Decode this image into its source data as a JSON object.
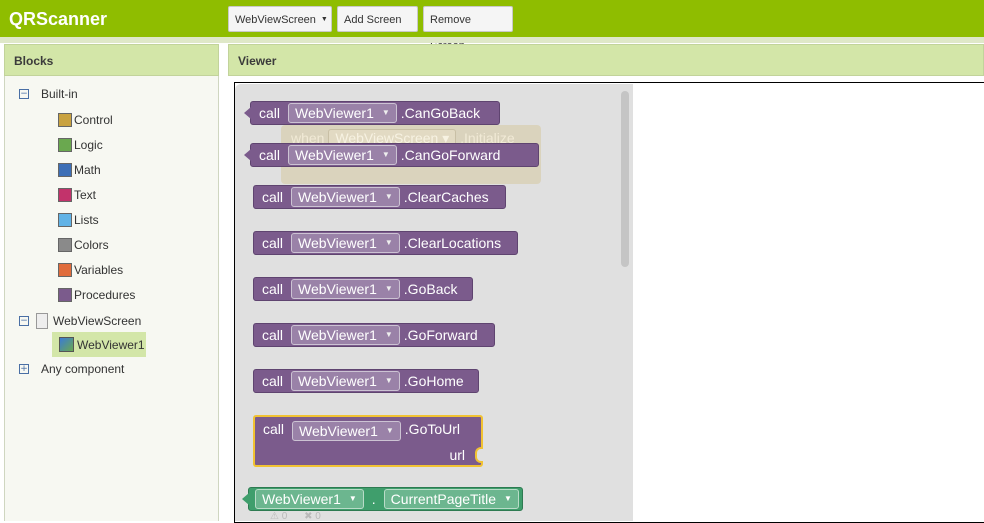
{
  "app": {
    "title": "QRScanner"
  },
  "toolbar": {
    "screen_select": "WebViewScreen",
    "add_screen": "Add Screen ...",
    "remove_screen": "Remove Screen"
  },
  "blocks_panel": {
    "title": "Blocks",
    "builtin": {
      "label": "Built-in",
      "items": [
        {
          "label": "Control",
          "color": "#c9a240"
        },
        {
          "label": "Logic",
          "color": "#6aa84f"
        },
        {
          "label": "Math",
          "color": "#3d6fb6"
        },
        {
          "label": "Text",
          "color": "#c2336b"
        },
        {
          "label": "Lists",
          "color": "#62b3e6"
        },
        {
          "label": "Colors",
          "color": "#8a8a8a"
        },
        {
          "label": "Variables",
          "color": "#e06c3c"
        },
        {
          "label": "Procedures",
          "color": "#7b5b8c"
        }
      ]
    },
    "screen": {
      "label": "WebViewScreen",
      "component": "WebViewer1"
    },
    "any_component": "Any component"
  },
  "viewer": {
    "title": "Viewer",
    "ghost_event": {
      "keyword": "when",
      "component": "WebViewScreen",
      "event": ".Initialize"
    },
    "blocks": [
      {
        "keyword": "call",
        "component": "WebViewer1",
        "method": ".CanGoBack"
      },
      {
        "keyword": "call",
        "component": "WebViewer1",
        "method": ".CanGoForward"
      },
      {
        "keyword": "call",
        "component": "WebViewer1",
        "method": ".ClearCaches"
      },
      {
        "keyword": "call",
        "component": "WebViewer1",
        "method": ".ClearLocations"
      },
      {
        "keyword": "call",
        "component": "WebViewer1",
        "method": ".GoBack"
      },
      {
        "keyword": "call",
        "component": "WebViewer1",
        "method": ".GoForward"
      },
      {
        "keyword": "call",
        "component": "WebViewer1",
        "method": ".GoHome"
      },
      {
        "keyword": "call",
        "component": "WebViewer1",
        "method": ".GoToUrl",
        "param": "url"
      }
    ],
    "property_block": {
      "component": "WebViewer1",
      "dot": ".",
      "property": "CurrentPageTitle"
    },
    "warnings": {
      "warning_count": "0",
      "error_count": "0"
    }
  }
}
